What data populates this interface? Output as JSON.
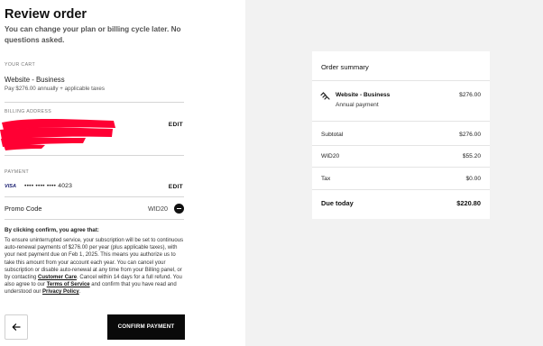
{
  "header": {
    "title": "Review order",
    "subtitle": "You can change your plan or billing cycle later. No questions asked."
  },
  "cart": {
    "section_label": "YOUR CART",
    "item_name": "Website - Business",
    "item_desc": "Pay $276.00 annually + applicable taxes"
  },
  "billing": {
    "section_label": "BILLING ADDRESS",
    "edit_label": "EDIT"
  },
  "payment": {
    "section_label": "PAYMENT",
    "card_brand": "VISA",
    "card_number": "•••• •••• •••• 4023",
    "edit_label": "EDIT"
  },
  "promo": {
    "label": "Promo Code",
    "code": "WID20"
  },
  "agreement": {
    "heading": "By clicking confirm, you agree that:",
    "text_1": "To ensure uninterrupted service, your subscription will be set to continuous auto-renewal payments of $276.00 per year (plus applicable taxes), with your next payment due on Feb 1, 2025. This means you authorize us to take this amount from your account each year. You can cancel your subscription or disable auto-renewal at any time from your Billing panel, or by contacting ",
    "link_support": "Customer Care",
    "text_2": ". Cancel within 14 days for a full refund. You also agree to our ",
    "link_tos": "Terms of Service",
    "text_3": " and confirm that you have read and understood our ",
    "link_privacy": "Privacy Policy",
    "text_4": "."
  },
  "actions": {
    "back_icon": "arrow-left-icon",
    "confirm_label": "CONFIRM PAYMENT"
  },
  "summary": {
    "title": "Order summary",
    "item_icon": "squarespace-logo-icon",
    "item_name": "Website - Business",
    "item_sub": "Annual payment",
    "item_price": "$276.00",
    "subtotal_label": "Subtotal",
    "subtotal_value": "$276.00",
    "discount_label": "WID20",
    "discount_value": "$55.20",
    "tax_label": "Tax",
    "tax_value": "$0.00",
    "total_label": "Due today",
    "total_value": "$220.80"
  },
  "colors": {
    "confirm_bg": "#0a0a0a",
    "redaction": "#ff0033",
    "visa": "#1a1f71"
  }
}
